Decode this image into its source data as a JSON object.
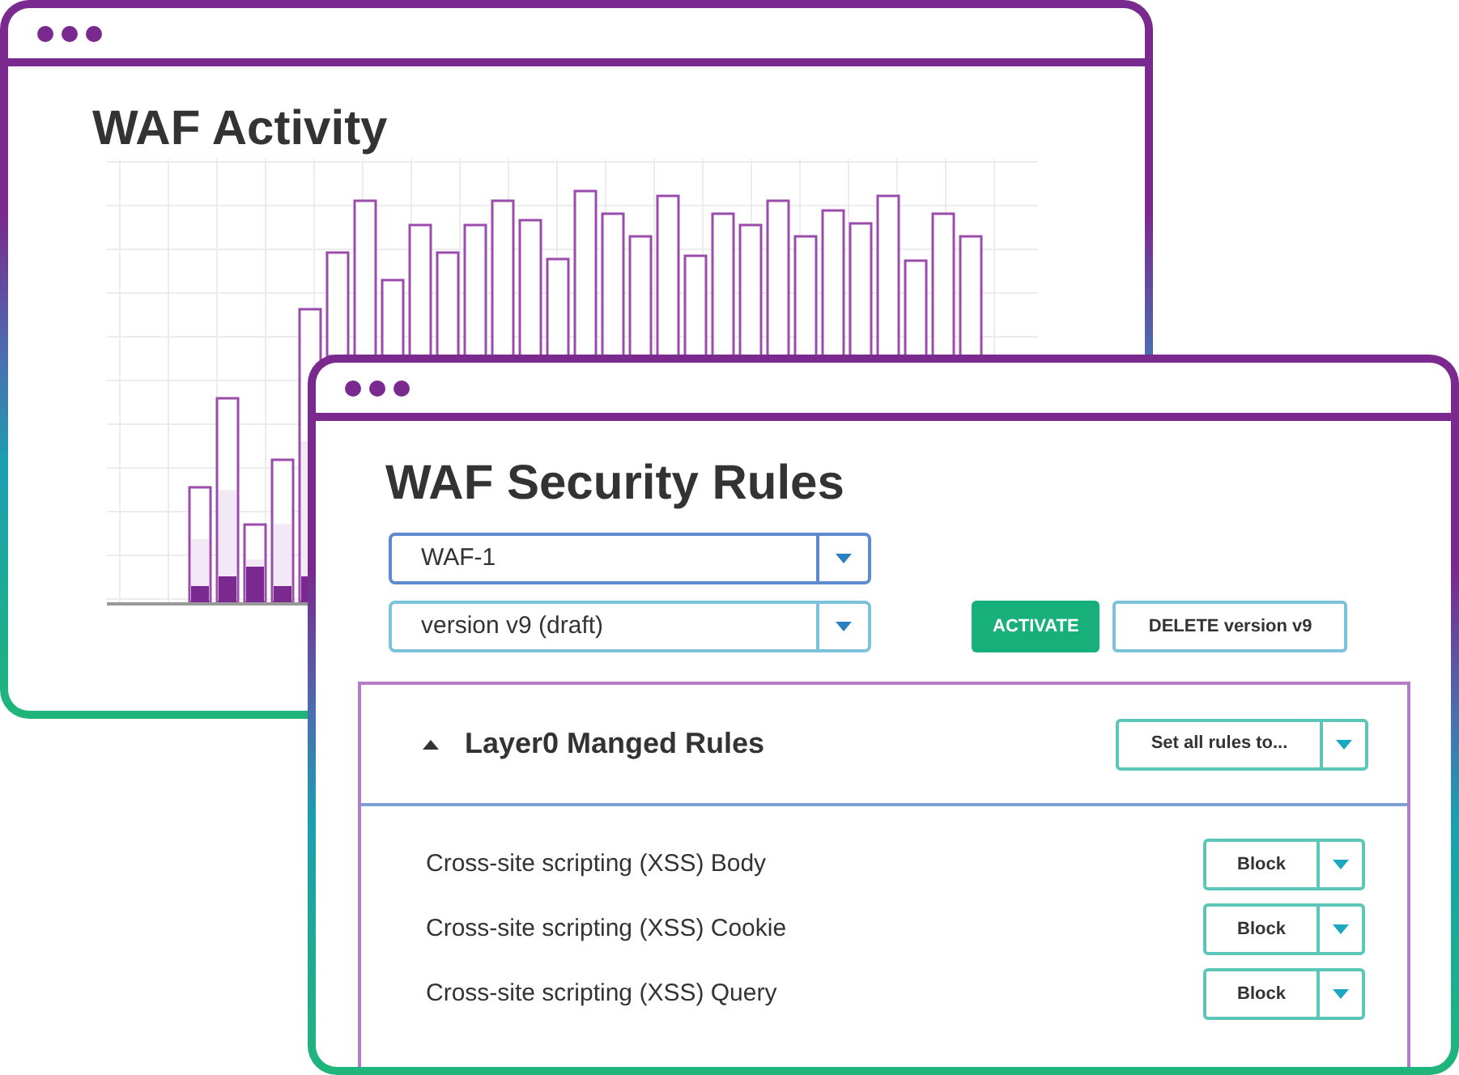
{
  "back_window": {
    "title": "WAF Activity"
  },
  "front_window": {
    "title": "WAF Security Rules",
    "selects": [
      {
        "value": "WAF-1"
      },
      {
        "value": "version v9 (draft)"
      }
    ],
    "buttons": [
      {
        "label": "ACTIVATE",
        "kind": "primary"
      },
      {
        "label": "DELETE version v9",
        "kind": "outline"
      }
    ],
    "panel": {
      "title": "Layer0 Manged Rules",
      "expanded": true,
      "bulk_action": "Set all rules to...",
      "rules": [
        {
          "name": "Cross-site scripting (XSS) Body",
          "action": "Block"
        },
        {
          "name": "Cross-site scripting (XSS) Cookie",
          "action": "Block"
        },
        {
          "name": "Cross-site scripting (XSS) Query",
          "action": "Block"
        }
      ]
    }
  }
}
